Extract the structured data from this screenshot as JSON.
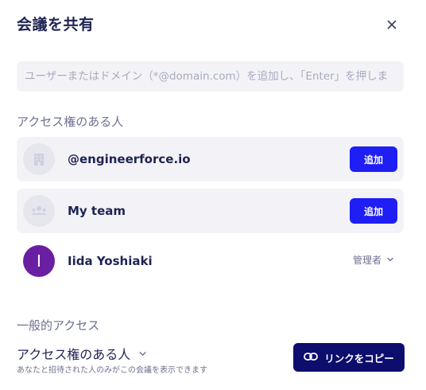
{
  "dialog": {
    "title": "会議を共有",
    "close_icon": "close-icon"
  },
  "search": {
    "placeholder": "ユーザーまたはドメイン（*@domain.com）を追加し、「Enter」を押しま",
    "value": ""
  },
  "access_section": {
    "title": "アクセス権のある人",
    "members": [
      {
        "name": "@engineerforce.io",
        "icon": "building-icon",
        "action_label": "追加"
      },
      {
        "name": "My team",
        "icon": "team-icon",
        "action_label": "追加"
      },
      {
        "name": "Iida Yoshiaki",
        "initial": "I",
        "role": "管理者",
        "avatar_color": "#6a1fa3"
      }
    ]
  },
  "general_section": {
    "title": "一般的アクセス",
    "selected": "アクセス権のある人",
    "description": "あなたと招待された人のみがこの会議を表示できます"
  },
  "copy_link": {
    "label": "リンクをコピー",
    "icon": "link-icon"
  },
  "colors": {
    "primary": "#1e1ef5",
    "dark_primary": "#0d0d6e",
    "row_background": "#f3f3f7"
  }
}
